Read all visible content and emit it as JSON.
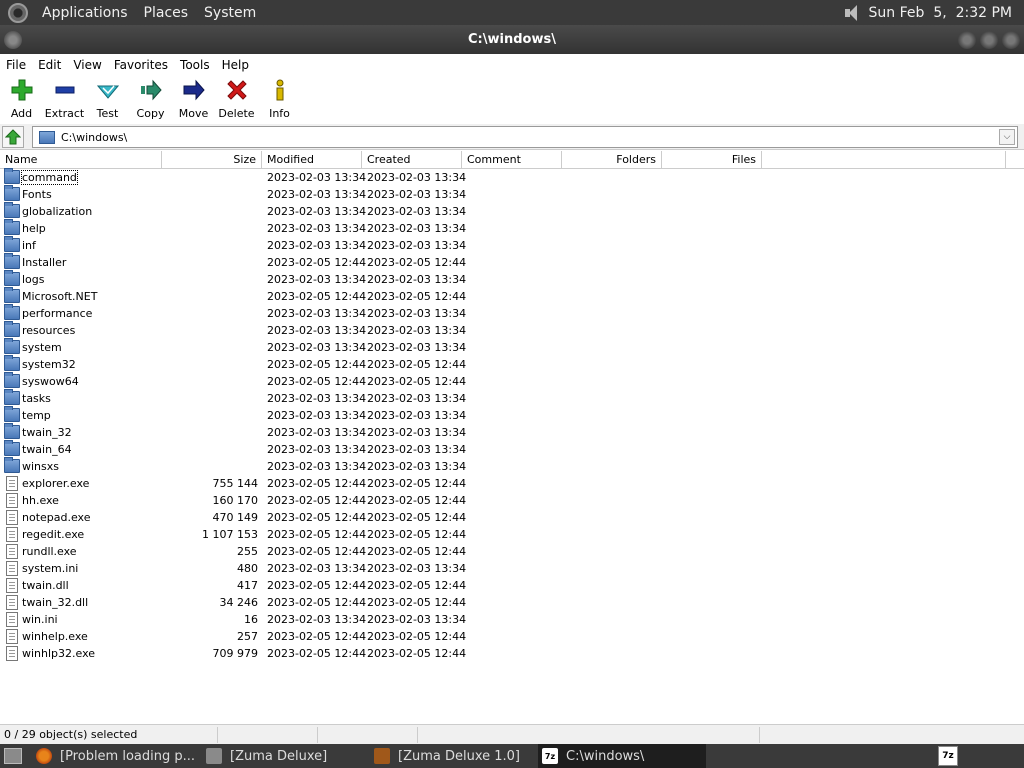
{
  "top_panel": {
    "menus": [
      "Applications",
      "Places",
      "System"
    ],
    "clock": "Sun Feb  5,  2:32 PM"
  },
  "window": {
    "title": "C:\\windows\\"
  },
  "menubar": {
    "items": [
      {
        "label": "File"
      },
      {
        "label": "Edit"
      },
      {
        "label": "View"
      },
      {
        "label": "Favorites"
      },
      {
        "label": "Tools"
      },
      {
        "label": "Help"
      }
    ]
  },
  "toolbar": {
    "buttons": [
      {
        "label": "Add",
        "icon": "plus-icon",
        "color": "#2eaa2e"
      },
      {
        "label": "Extract",
        "icon": "minus-icon",
        "color": "#1f3fa6"
      },
      {
        "label": "Test",
        "icon": "check-icon",
        "color": "#38b8c8"
      },
      {
        "label": "Copy",
        "icon": "arrow-right-icon",
        "color": "#2a8a6a"
      },
      {
        "label": "Move",
        "icon": "arrow-right-icon",
        "color": "#1b2a8a"
      },
      {
        "label": "Delete",
        "icon": "x-icon",
        "color": "#d01818"
      },
      {
        "label": "Info",
        "icon": "info-icon",
        "color": "#d8b800"
      }
    ]
  },
  "address": {
    "path": "C:\\windows\\"
  },
  "columns": [
    "Name",
    "Size",
    "Modified",
    "Created",
    "Comment",
    "Folders",
    "Files"
  ],
  "rows": [
    {
      "type": "folder",
      "name": "command",
      "size": "",
      "modified": "2023-02-03 13:34",
      "created": "2023-02-03 13:34"
    },
    {
      "type": "folder",
      "name": "Fonts",
      "size": "",
      "modified": "2023-02-03 13:34",
      "created": "2023-02-03 13:34"
    },
    {
      "type": "folder",
      "name": "globalization",
      "size": "",
      "modified": "2023-02-03 13:34",
      "created": "2023-02-03 13:34"
    },
    {
      "type": "folder",
      "name": "help",
      "size": "",
      "modified": "2023-02-03 13:34",
      "created": "2023-02-03 13:34"
    },
    {
      "type": "folder",
      "name": "inf",
      "size": "",
      "modified": "2023-02-03 13:34",
      "created": "2023-02-03 13:34"
    },
    {
      "type": "folder",
      "name": "Installer",
      "size": "",
      "modified": "2023-02-05 12:44",
      "created": "2023-02-05 12:44"
    },
    {
      "type": "folder",
      "name": "logs",
      "size": "",
      "modified": "2023-02-03 13:34",
      "created": "2023-02-03 13:34"
    },
    {
      "type": "folder",
      "name": "Microsoft.NET",
      "size": "",
      "modified": "2023-02-05 12:44",
      "created": "2023-02-05 12:44"
    },
    {
      "type": "folder",
      "name": "performance",
      "size": "",
      "modified": "2023-02-03 13:34",
      "created": "2023-02-03 13:34"
    },
    {
      "type": "folder",
      "name": "resources",
      "size": "",
      "modified": "2023-02-03 13:34",
      "created": "2023-02-03 13:34"
    },
    {
      "type": "folder",
      "name": "system",
      "size": "",
      "modified": "2023-02-03 13:34",
      "created": "2023-02-03 13:34"
    },
    {
      "type": "folder",
      "name": "system32",
      "size": "",
      "modified": "2023-02-05 12:44",
      "created": "2023-02-05 12:44"
    },
    {
      "type": "folder",
      "name": "syswow64",
      "size": "",
      "modified": "2023-02-05 12:44",
      "created": "2023-02-05 12:44"
    },
    {
      "type": "folder",
      "name": "tasks",
      "size": "",
      "modified": "2023-02-03 13:34",
      "created": "2023-02-03 13:34"
    },
    {
      "type": "folder",
      "name": "temp",
      "size": "",
      "modified": "2023-02-03 13:34",
      "created": "2023-02-03 13:34"
    },
    {
      "type": "folder",
      "name": "twain_32",
      "size": "",
      "modified": "2023-02-03 13:34",
      "created": "2023-02-03 13:34"
    },
    {
      "type": "folder",
      "name": "twain_64",
      "size": "",
      "modified": "2023-02-03 13:34",
      "created": "2023-02-03 13:34"
    },
    {
      "type": "folder",
      "name": "winsxs",
      "size": "",
      "modified": "2023-02-03 13:34",
      "created": "2023-02-03 13:34"
    },
    {
      "type": "file",
      "name": "explorer.exe",
      "size": "755 144",
      "modified": "2023-02-05 12:44",
      "created": "2023-02-05 12:44"
    },
    {
      "type": "file",
      "name": "hh.exe",
      "size": "160 170",
      "modified": "2023-02-05 12:44",
      "created": "2023-02-05 12:44"
    },
    {
      "type": "file",
      "name": "notepad.exe",
      "size": "470 149",
      "modified": "2023-02-05 12:44",
      "created": "2023-02-05 12:44"
    },
    {
      "type": "file",
      "name": "regedit.exe",
      "size": "1 107 153",
      "modified": "2023-02-05 12:44",
      "created": "2023-02-05 12:44"
    },
    {
      "type": "file",
      "name": "rundll.exe",
      "size": "255",
      "modified": "2023-02-05 12:44",
      "created": "2023-02-05 12:44"
    },
    {
      "type": "file",
      "name": "system.ini",
      "size": "480",
      "modified": "2023-02-03 13:34",
      "created": "2023-02-03 13:34"
    },
    {
      "type": "file",
      "name": "twain.dll",
      "size": "417",
      "modified": "2023-02-05 12:44",
      "created": "2023-02-05 12:44"
    },
    {
      "type": "file",
      "name": "twain_32.dll",
      "size": "34 246",
      "modified": "2023-02-05 12:44",
      "created": "2023-02-05 12:44"
    },
    {
      "type": "file",
      "name": "win.ini",
      "size": "16",
      "modified": "2023-02-03 13:34",
      "created": "2023-02-03 13:34"
    },
    {
      "type": "file",
      "name": "winhelp.exe",
      "size": "257",
      "modified": "2023-02-05 12:44",
      "created": "2023-02-05 12:44"
    },
    {
      "type": "file",
      "name": "winhlp32.exe",
      "size": "709 979",
      "modified": "2023-02-05 12:44",
      "created": "2023-02-05 12:44"
    }
  ],
  "status": {
    "selection": "0 / 29 object(s) selected"
  },
  "taskbar": {
    "tasks": [
      {
        "label": "[Problem loading p...",
        "icon": "firefox-icon"
      },
      {
        "label": "[Zuma Deluxe]",
        "icon": "folder-icon"
      },
      {
        "label": "[Zuma Deluxe 1.0]",
        "icon": "zuma-icon"
      },
      {
        "label": "C:\\windows\\",
        "icon": "7zip-icon"
      }
    ],
    "tray_label": "7z"
  }
}
